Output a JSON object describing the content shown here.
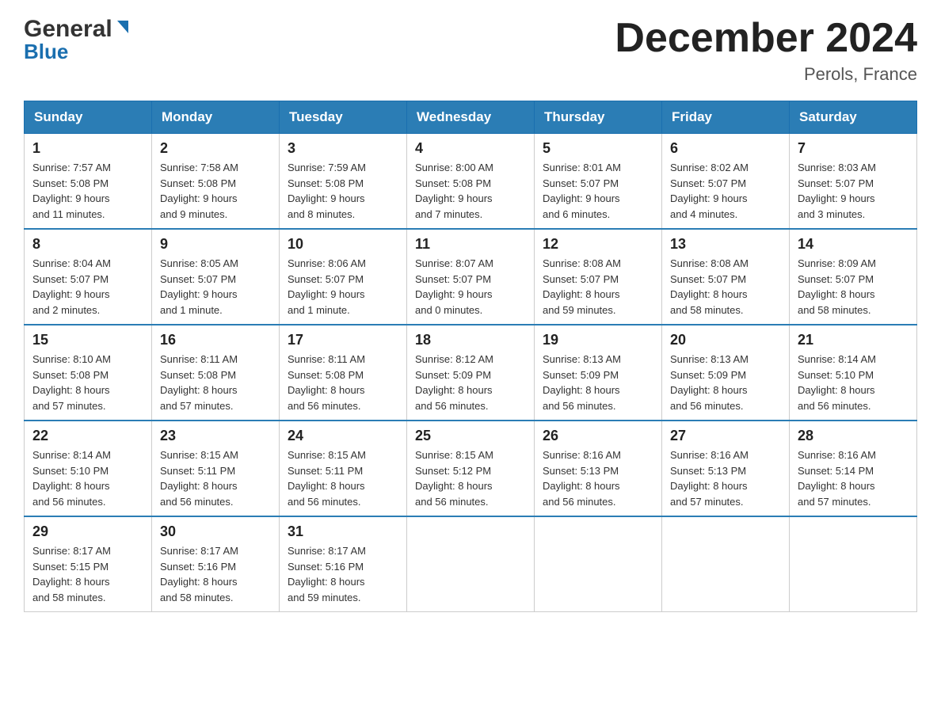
{
  "header": {
    "logo_general": "General",
    "logo_blue": "Blue",
    "title": "December 2024",
    "location": "Perols, France"
  },
  "days_header": [
    "Sunday",
    "Monday",
    "Tuesday",
    "Wednesday",
    "Thursday",
    "Friday",
    "Saturday"
  ],
  "weeks": [
    [
      {
        "day": "1",
        "sunrise": "Sunrise: 7:57 AM",
        "sunset": "Sunset: 5:08 PM",
        "daylight": "Daylight: 9 hours",
        "daylight2": "and 11 minutes."
      },
      {
        "day": "2",
        "sunrise": "Sunrise: 7:58 AM",
        "sunset": "Sunset: 5:08 PM",
        "daylight": "Daylight: 9 hours",
        "daylight2": "and 9 minutes."
      },
      {
        "day": "3",
        "sunrise": "Sunrise: 7:59 AM",
        "sunset": "Sunset: 5:08 PM",
        "daylight": "Daylight: 9 hours",
        "daylight2": "and 8 minutes."
      },
      {
        "day": "4",
        "sunrise": "Sunrise: 8:00 AM",
        "sunset": "Sunset: 5:08 PM",
        "daylight": "Daylight: 9 hours",
        "daylight2": "and 7 minutes."
      },
      {
        "day": "5",
        "sunrise": "Sunrise: 8:01 AM",
        "sunset": "Sunset: 5:07 PM",
        "daylight": "Daylight: 9 hours",
        "daylight2": "and 6 minutes."
      },
      {
        "day": "6",
        "sunrise": "Sunrise: 8:02 AM",
        "sunset": "Sunset: 5:07 PM",
        "daylight": "Daylight: 9 hours",
        "daylight2": "and 4 minutes."
      },
      {
        "day": "7",
        "sunrise": "Sunrise: 8:03 AM",
        "sunset": "Sunset: 5:07 PM",
        "daylight": "Daylight: 9 hours",
        "daylight2": "and 3 minutes."
      }
    ],
    [
      {
        "day": "8",
        "sunrise": "Sunrise: 8:04 AM",
        "sunset": "Sunset: 5:07 PM",
        "daylight": "Daylight: 9 hours",
        "daylight2": "and 2 minutes."
      },
      {
        "day": "9",
        "sunrise": "Sunrise: 8:05 AM",
        "sunset": "Sunset: 5:07 PM",
        "daylight": "Daylight: 9 hours",
        "daylight2": "and 1 minute."
      },
      {
        "day": "10",
        "sunrise": "Sunrise: 8:06 AM",
        "sunset": "Sunset: 5:07 PM",
        "daylight": "Daylight: 9 hours",
        "daylight2": "and 1 minute."
      },
      {
        "day": "11",
        "sunrise": "Sunrise: 8:07 AM",
        "sunset": "Sunset: 5:07 PM",
        "daylight": "Daylight: 9 hours",
        "daylight2": "and 0 minutes."
      },
      {
        "day": "12",
        "sunrise": "Sunrise: 8:08 AM",
        "sunset": "Sunset: 5:07 PM",
        "daylight": "Daylight: 8 hours",
        "daylight2": "and 59 minutes."
      },
      {
        "day": "13",
        "sunrise": "Sunrise: 8:08 AM",
        "sunset": "Sunset: 5:07 PM",
        "daylight": "Daylight: 8 hours",
        "daylight2": "and 58 minutes."
      },
      {
        "day": "14",
        "sunrise": "Sunrise: 8:09 AM",
        "sunset": "Sunset: 5:07 PM",
        "daylight": "Daylight: 8 hours",
        "daylight2": "and 58 minutes."
      }
    ],
    [
      {
        "day": "15",
        "sunrise": "Sunrise: 8:10 AM",
        "sunset": "Sunset: 5:08 PM",
        "daylight": "Daylight: 8 hours",
        "daylight2": "and 57 minutes."
      },
      {
        "day": "16",
        "sunrise": "Sunrise: 8:11 AM",
        "sunset": "Sunset: 5:08 PM",
        "daylight": "Daylight: 8 hours",
        "daylight2": "and 57 minutes."
      },
      {
        "day": "17",
        "sunrise": "Sunrise: 8:11 AM",
        "sunset": "Sunset: 5:08 PM",
        "daylight": "Daylight: 8 hours",
        "daylight2": "and 56 minutes."
      },
      {
        "day": "18",
        "sunrise": "Sunrise: 8:12 AM",
        "sunset": "Sunset: 5:09 PM",
        "daylight": "Daylight: 8 hours",
        "daylight2": "and 56 minutes."
      },
      {
        "day": "19",
        "sunrise": "Sunrise: 8:13 AM",
        "sunset": "Sunset: 5:09 PM",
        "daylight": "Daylight: 8 hours",
        "daylight2": "and 56 minutes."
      },
      {
        "day": "20",
        "sunrise": "Sunrise: 8:13 AM",
        "sunset": "Sunset: 5:09 PM",
        "daylight": "Daylight: 8 hours",
        "daylight2": "and 56 minutes."
      },
      {
        "day": "21",
        "sunrise": "Sunrise: 8:14 AM",
        "sunset": "Sunset: 5:10 PM",
        "daylight": "Daylight: 8 hours",
        "daylight2": "and 56 minutes."
      }
    ],
    [
      {
        "day": "22",
        "sunrise": "Sunrise: 8:14 AM",
        "sunset": "Sunset: 5:10 PM",
        "daylight": "Daylight: 8 hours",
        "daylight2": "and 56 minutes."
      },
      {
        "day": "23",
        "sunrise": "Sunrise: 8:15 AM",
        "sunset": "Sunset: 5:11 PM",
        "daylight": "Daylight: 8 hours",
        "daylight2": "and 56 minutes."
      },
      {
        "day": "24",
        "sunrise": "Sunrise: 8:15 AM",
        "sunset": "Sunset: 5:11 PM",
        "daylight": "Daylight: 8 hours",
        "daylight2": "and 56 minutes."
      },
      {
        "day": "25",
        "sunrise": "Sunrise: 8:15 AM",
        "sunset": "Sunset: 5:12 PM",
        "daylight": "Daylight: 8 hours",
        "daylight2": "and 56 minutes."
      },
      {
        "day": "26",
        "sunrise": "Sunrise: 8:16 AM",
        "sunset": "Sunset: 5:13 PM",
        "daylight": "Daylight: 8 hours",
        "daylight2": "and 56 minutes."
      },
      {
        "day": "27",
        "sunrise": "Sunrise: 8:16 AM",
        "sunset": "Sunset: 5:13 PM",
        "daylight": "Daylight: 8 hours",
        "daylight2": "and 57 minutes."
      },
      {
        "day": "28",
        "sunrise": "Sunrise: 8:16 AM",
        "sunset": "Sunset: 5:14 PM",
        "daylight": "Daylight: 8 hours",
        "daylight2": "and 57 minutes."
      }
    ],
    [
      {
        "day": "29",
        "sunrise": "Sunrise: 8:17 AM",
        "sunset": "Sunset: 5:15 PM",
        "daylight": "Daylight: 8 hours",
        "daylight2": "and 58 minutes."
      },
      {
        "day": "30",
        "sunrise": "Sunrise: 8:17 AM",
        "sunset": "Sunset: 5:16 PM",
        "daylight": "Daylight: 8 hours",
        "daylight2": "and 58 minutes."
      },
      {
        "day": "31",
        "sunrise": "Sunrise: 8:17 AM",
        "sunset": "Sunset: 5:16 PM",
        "daylight": "Daylight: 8 hours",
        "daylight2": "and 59 minutes."
      },
      null,
      null,
      null,
      null
    ]
  ]
}
